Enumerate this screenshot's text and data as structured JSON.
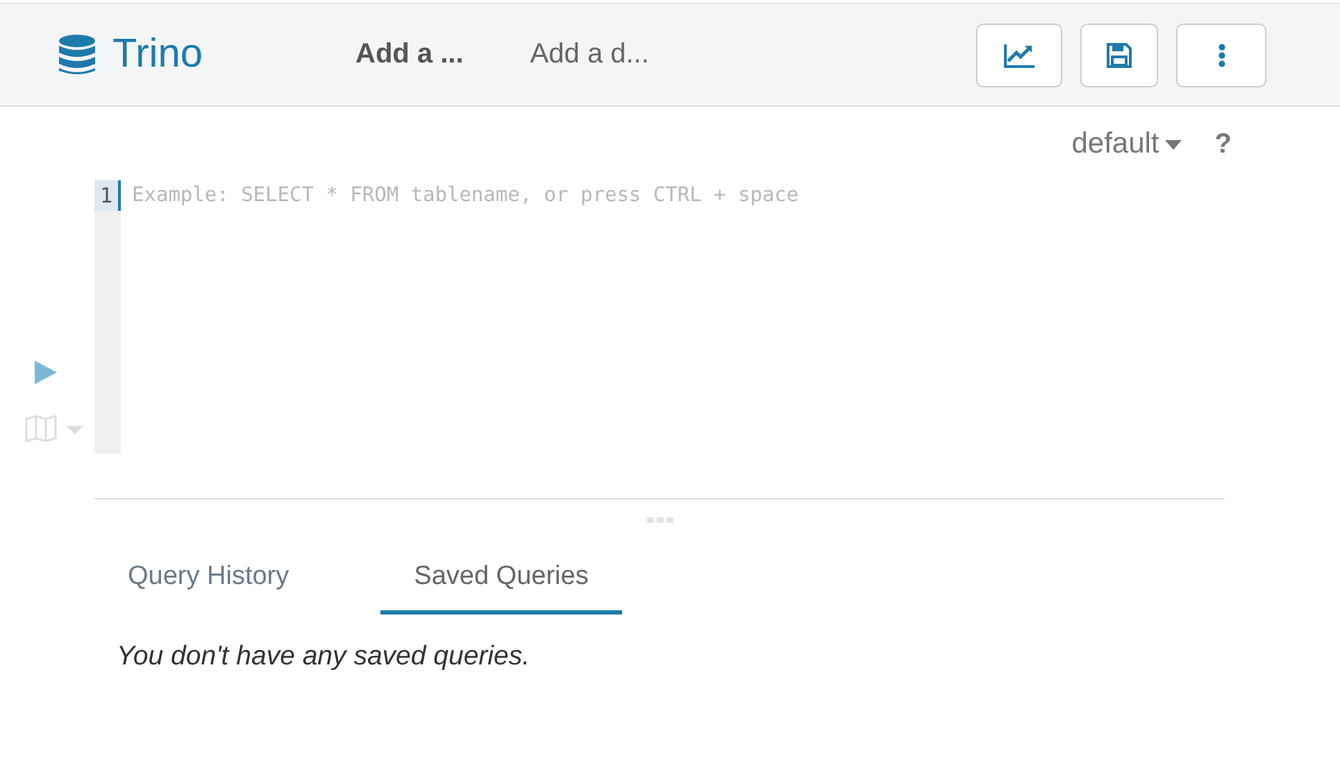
{
  "header": {
    "title": "Trino",
    "session_name": "Add a ...",
    "session_description": "Add a d..."
  },
  "editor": {
    "database": "default",
    "help": "?",
    "line_numbers": [
      "1"
    ],
    "placeholder": "Example: SELECT * FROM tablename, or press CTRL + space"
  },
  "tabs": [
    {
      "label": "Query History",
      "selected": false
    },
    {
      "label": "Saved Queries",
      "selected": true
    }
  ],
  "empty_message": "You don't have any saved queries."
}
